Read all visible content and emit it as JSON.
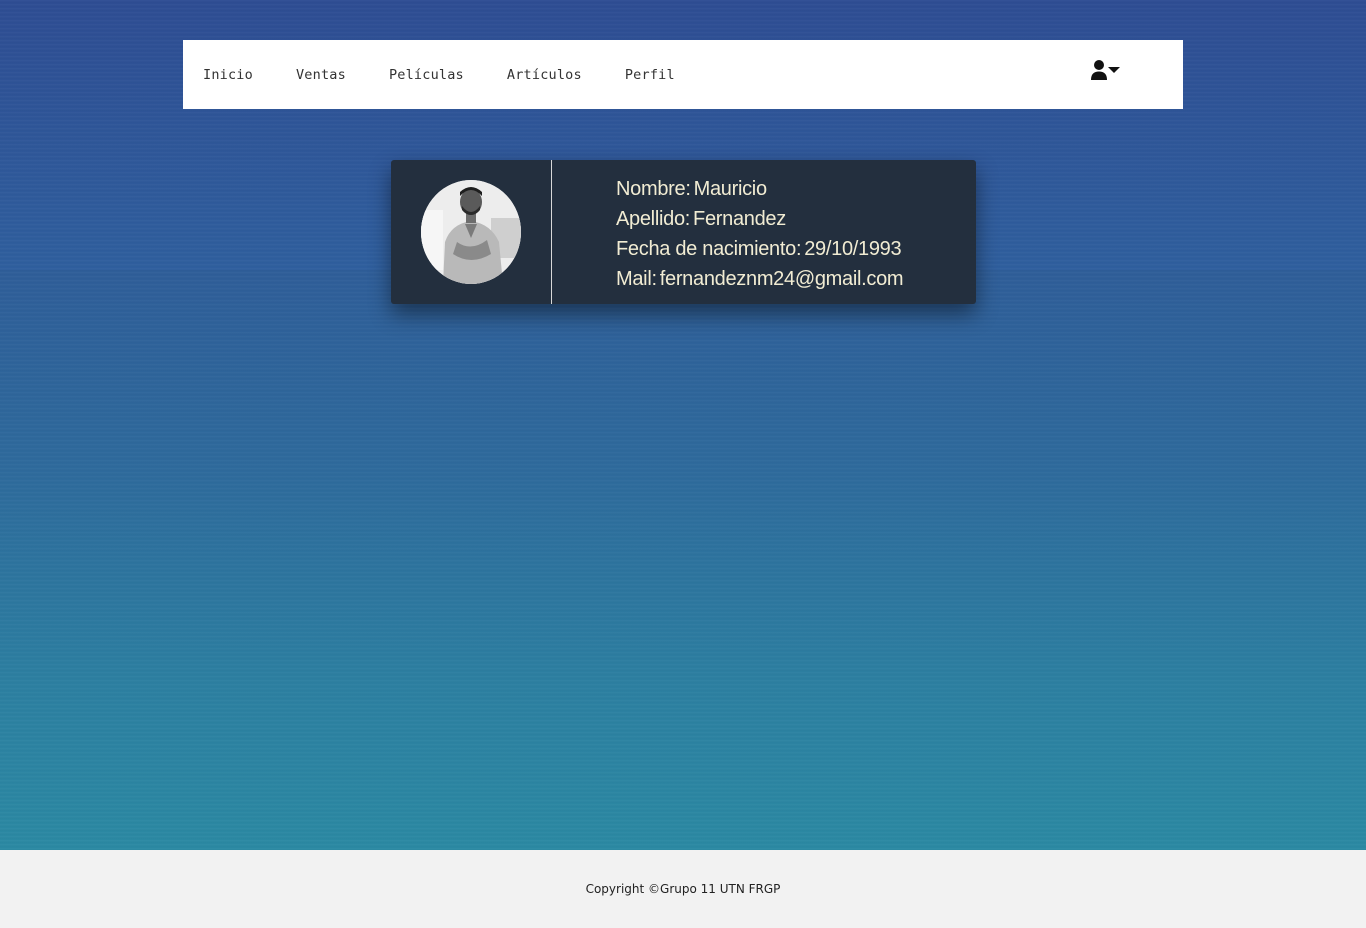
{
  "nav": {
    "items": [
      {
        "label": "Inicio"
      },
      {
        "label": "Ventas"
      },
      {
        "label": "Películas"
      },
      {
        "label": "Artículos"
      },
      {
        "label": "Perfil"
      }
    ],
    "user_icon": "user-dropdown-icon"
  },
  "profile": {
    "avatar_icon": "avatar-photo",
    "fields": [
      {
        "label": "Nombre:",
        "value": "Mauricio"
      },
      {
        "label": "Apellido:",
        "value": "Fernandez"
      },
      {
        "label": "Fecha de nacimiento:",
        "value": "29/10/1993"
      },
      {
        "label": "Mail:",
        "value": "fernandeznm24@gmail.com"
      }
    ]
  },
  "footer": {
    "text": "Copyright ©Grupo 11 UTN FRGP"
  },
  "colors": {
    "card_bg": "#232f3e",
    "card_text": "#f1ecd3",
    "nav_bg": "#ffffff",
    "footer_bg": "#f2f2f2",
    "background_top": "#2e4d93",
    "background_bottom": "#2b89a3"
  }
}
